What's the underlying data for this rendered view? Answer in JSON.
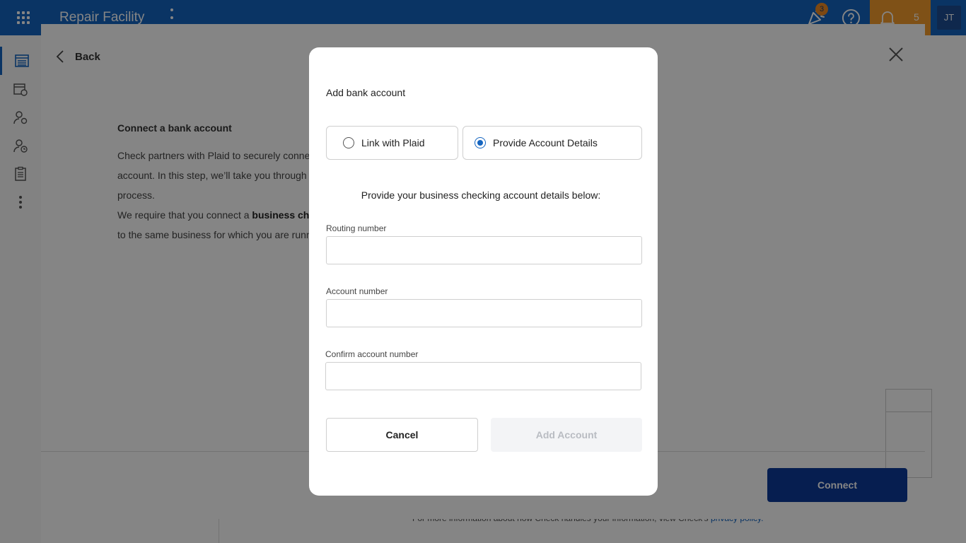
{
  "header": {
    "app_title": "Repair Facility",
    "whats_new_badge": "3",
    "notification_count": "5",
    "user_initials": "JT"
  },
  "sheet": {
    "back_label": "Back",
    "heading": "Connect a bank account",
    "para1_line1": "Check partners with Plaid to securely conne",
    "para1_line2": "account. In this step, we’ll take you through",
    "para1_line3": "process.",
    "para2_line1_start": "We require that you connect a ",
    "para2_line1_bold": "business che",
    "para2_line2": "to the same business for which you are runn",
    "connect_label": "Connect",
    "footer_text": "For more information about how Check handles your information, view Check’s ",
    "footer_link": "privacy policy."
  },
  "modal": {
    "title": "Add bank account",
    "option_plaid": "Link with Plaid",
    "option_details": "Provide Account Details",
    "selected_option": "details",
    "instructions": "Provide your business checking account details below:",
    "routing_label": "Routing number",
    "routing_value": "",
    "account_label": "Account number",
    "account_value": "",
    "confirm_label": "Confirm account number",
    "confirm_value": "",
    "cancel_label": "Cancel",
    "add_label": "Add Account"
  },
  "colors": {
    "brand_blue": "#1565c0",
    "notification_orange": "#f39c2c",
    "connect_navy": "#0d3a9a"
  }
}
